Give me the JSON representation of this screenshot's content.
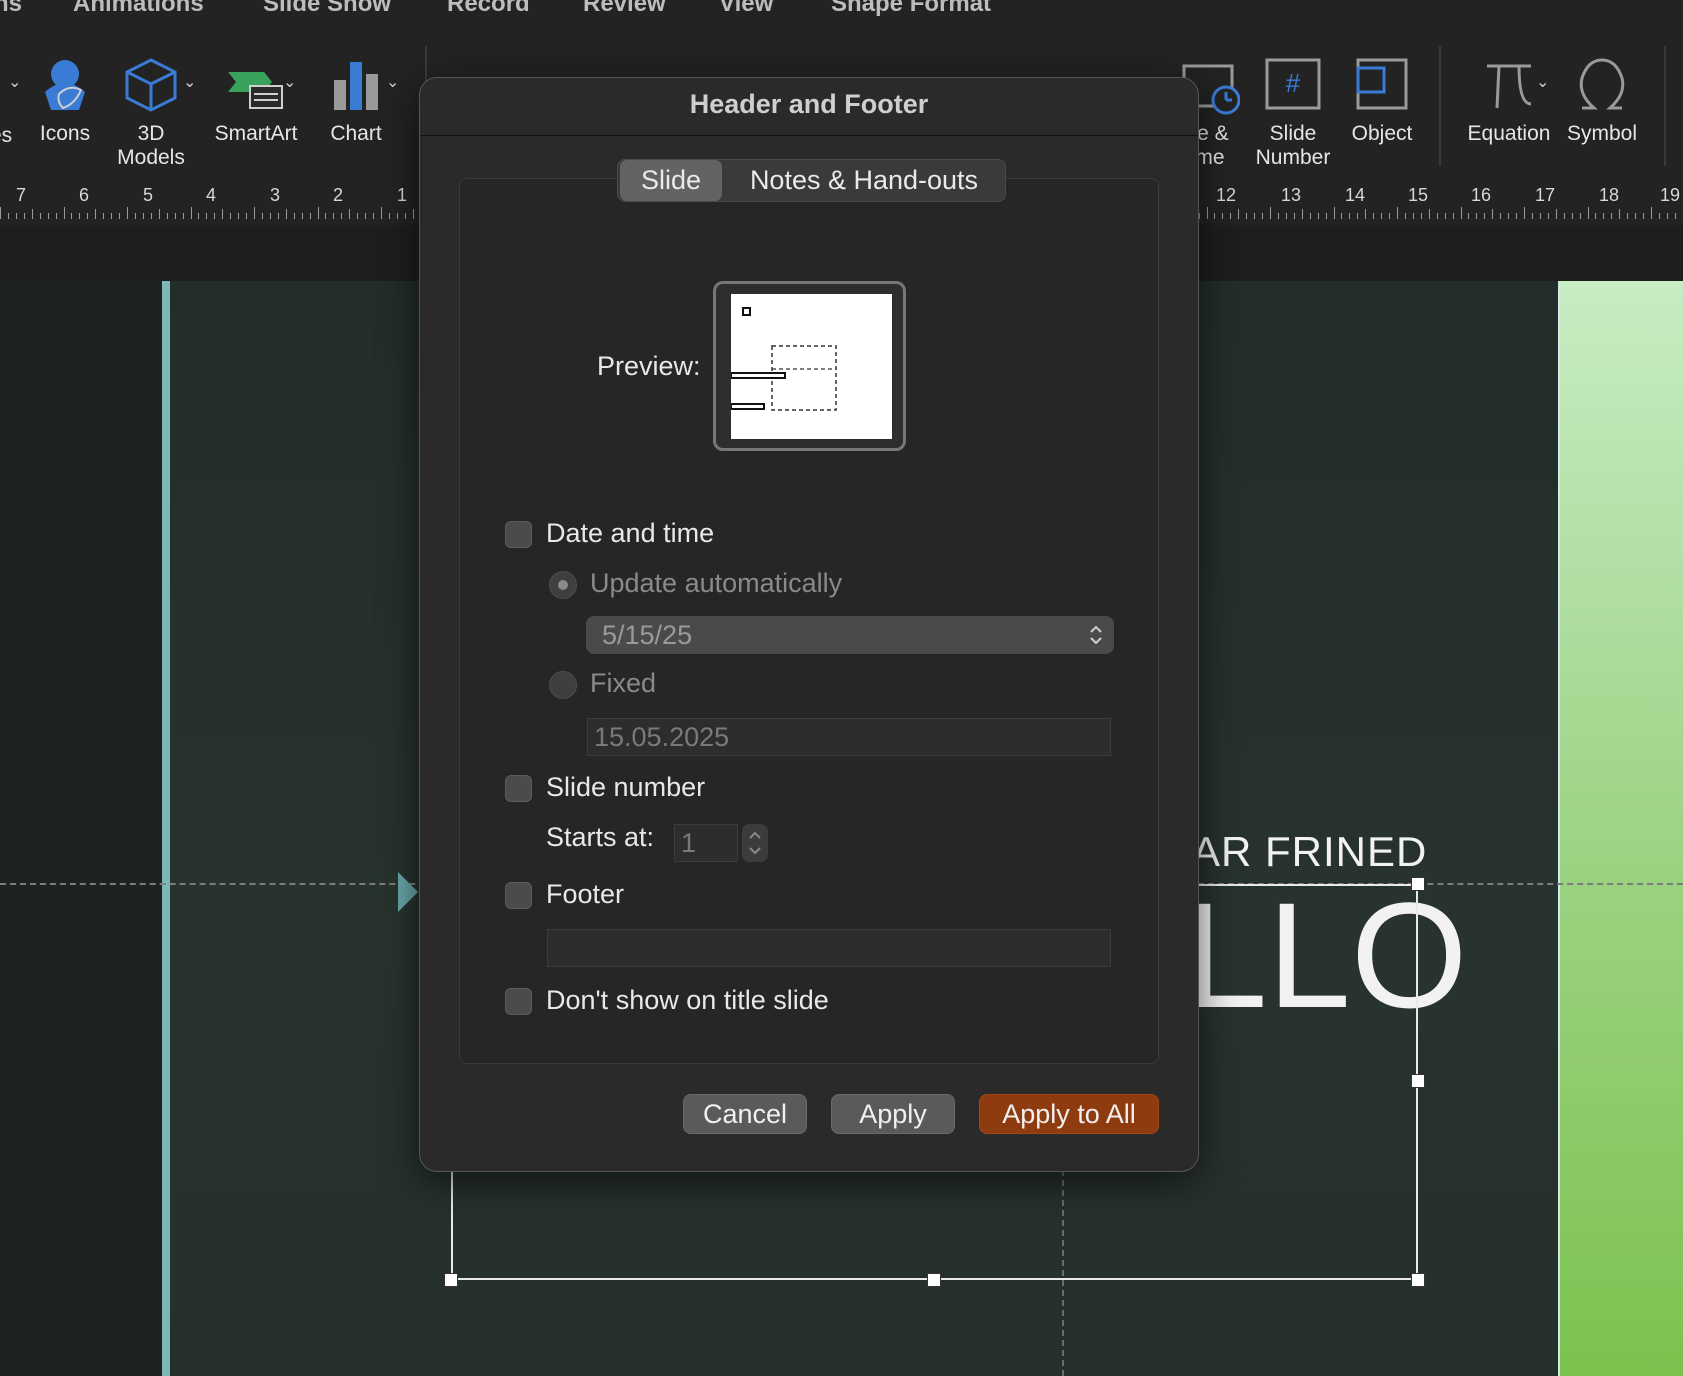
{
  "menu": {
    "tabs": [
      "ns",
      "Animations",
      "Slide Show",
      "Record",
      "Review",
      "View",
      "Shape Format"
    ]
  },
  "ribbon": {
    "items": [
      {
        "label": "es",
        "icon": "partial-icon"
      },
      {
        "label": "Icons",
        "icon": "icons-icon"
      },
      {
        "label": "3D\nModels",
        "label_line1": "3D",
        "label_line2": "Models",
        "icon": "3d-models-icon"
      },
      {
        "label": "SmartArt",
        "icon": "smartart-icon"
      },
      {
        "label": "Chart",
        "icon": "chart-icon"
      },
      {
        "label_line1": "te &",
        "label_line2": "me",
        "icon": "date-time-icon"
      },
      {
        "label_line1": "Slide",
        "label_line2": "Number",
        "icon": "slide-number-icon"
      },
      {
        "label": "Object",
        "icon": "object-icon"
      },
      {
        "label": "Equation",
        "icon": "equation-icon"
      },
      {
        "label": "Symbol",
        "icon": "symbol-icon"
      }
    ],
    "colors": {
      "blue_icon": "#3a7bd5",
      "green_icon": "#3aa35b"
    }
  },
  "ruler": {
    "left_numbers": [
      "7",
      "6",
      "5",
      "4",
      "3",
      "2",
      "1"
    ],
    "right_numbers": [
      "12",
      "13",
      "14",
      "15",
      "16",
      "17",
      "18",
      "19"
    ]
  },
  "slide": {
    "subtitle": "AR FRINED",
    "title": "LLO",
    "accent_color": "#7fb6b6"
  },
  "dialog": {
    "title": "Header and Footer",
    "tabs": [
      {
        "label": "Slide",
        "active": true
      },
      {
        "label": "Notes & Hand-outs",
        "active": false
      }
    ],
    "preview_label": "Preview:",
    "date_time": {
      "label": "Date and time",
      "checked": false,
      "update_auto_label": "Update automatically",
      "date_format_value": "5/15/25",
      "fixed_label": "Fixed",
      "fixed_value": "15.05.2025"
    },
    "slide_number": {
      "label": "Slide number",
      "checked": false,
      "starts_at_label": "Starts at:",
      "starts_at_value": "1"
    },
    "footer": {
      "label": "Footer",
      "checked": false,
      "value": ""
    },
    "dont_show_on_title": {
      "label": "Don't show on title slide",
      "checked": false
    },
    "buttons": {
      "cancel": "Cancel",
      "apply": "Apply",
      "apply_all": "Apply to All"
    },
    "primary_color": "#8f3b10"
  }
}
